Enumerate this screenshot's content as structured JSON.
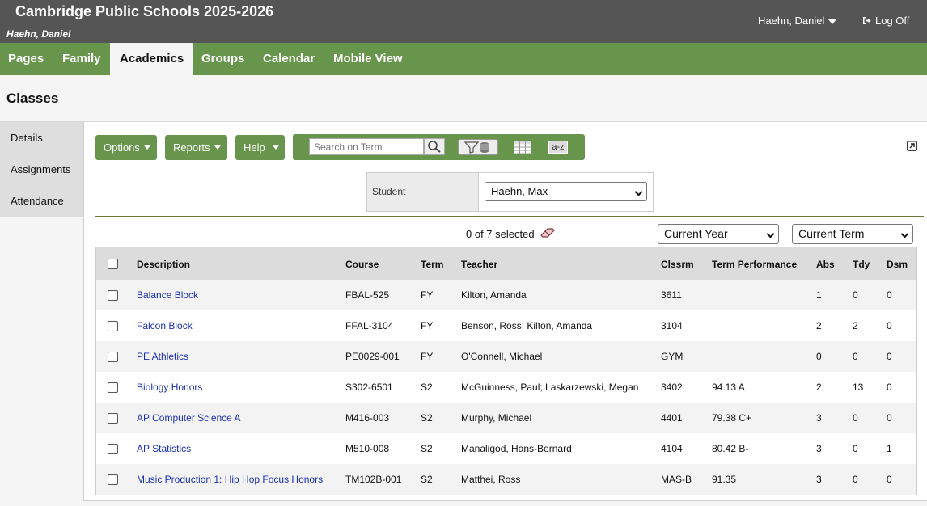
{
  "header": {
    "title": "Cambridge Public Schools 2025-2026",
    "user": "Haehn, Daniel",
    "user_menu": "Haehn, Daniel",
    "logoff": "Log Off"
  },
  "nav": {
    "tabs": [
      "Pages",
      "Family",
      "Academics",
      "Groups",
      "Calendar",
      "Mobile View"
    ],
    "active": "Academics"
  },
  "page_title": "Classes",
  "sidebar": {
    "items": [
      "Details",
      "Assignments",
      "Attendance"
    ]
  },
  "toolbar": {
    "options_label": "Options",
    "reports_label": "Reports",
    "help_label": "Help",
    "search_placeholder": "Search on Term",
    "az_label": "a-z"
  },
  "student": {
    "label": "Student",
    "selected": "Haehn, Max"
  },
  "selection": {
    "text": "0 of 7 selected"
  },
  "filters": {
    "year": "Current Year",
    "term": "Current Term"
  },
  "table": {
    "headers": [
      "Description",
      "Course",
      "Term",
      "Teacher",
      "Clssrm",
      "Term Performance",
      "Abs",
      "Tdy",
      "Dsm"
    ],
    "rows": [
      {
        "description": "Balance Block",
        "course": "FBAL-525",
        "term": "FY",
        "teacher": "Kilton, Amanda",
        "room": "3611",
        "perf": "",
        "abs": "1",
        "tdy": "0",
        "dsm": "0"
      },
      {
        "description": "Falcon Block",
        "course": "FFAL-3104",
        "term": "FY",
        "teacher": "Benson, Ross; Kilton, Amanda",
        "room": "3104",
        "perf": "",
        "abs": "2",
        "tdy": "2",
        "dsm": "0"
      },
      {
        "description": "PE Athletics",
        "course": "PE0029-001",
        "term": "FY",
        "teacher": "O'Connell, Michael",
        "room": "GYM",
        "perf": "",
        "abs": "0",
        "tdy": "0",
        "dsm": "0"
      },
      {
        "description": "Biology Honors",
        "course": "S302-6501",
        "term": "S2",
        "teacher": "McGuinness, Paul; Laskarzewski, Megan",
        "room": "3402",
        "perf": "94.13 A",
        "abs": "2",
        "tdy": "13",
        "dsm": "0"
      },
      {
        "description": "AP Computer Science A",
        "course": "M416-003",
        "term": "S2",
        "teacher": "Murphy, Michael",
        "room": "4401",
        "perf": "79.38 C+",
        "abs": "3",
        "tdy": "0",
        "dsm": "0"
      },
      {
        "description": "AP Statistics",
        "course": "M510-008",
        "term": "S2",
        "teacher": "Manaligod, Hans-Bernard",
        "room": "4104",
        "perf": "80.42 B-",
        "abs": "3",
        "tdy": "0",
        "dsm": "1"
      },
      {
        "description": "Music Production 1: Hip Hop Focus Honors",
        "course": "TM102B-001",
        "term": "S2",
        "teacher": "Matthei, Ross",
        "room": "MAS-B",
        "perf": "91.35",
        "abs": "3",
        "tdy": "0",
        "dsm": "0"
      }
    ]
  },
  "colors": {
    "header_bg": "#555555",
    "nav_bg": "#67954b",
    "link": "#1a2fb0"
  }
}
